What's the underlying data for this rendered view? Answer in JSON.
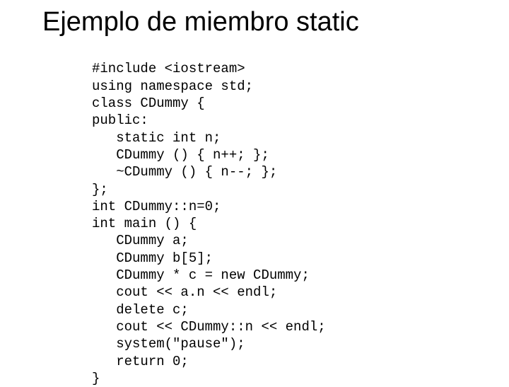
{
  "title": "Ejemplo de miembro static",
  "code": {
    "l1": "#include <iostream>",
    "l2": "using namespace std;",
    "l3": "class CDummy {",
    "l4": "public:",
    "l5": "   static int n;",
    "l6": "   CDummy () { n++; };",
    "l7": "   ~CDummy () { n--; };",
    "l8": "};",
    "l9": "int CDummy::n=0;",
    "l10": "int main () {",
    "l11": "   CDummy a;",
    "l12": "   CDummy b[5];",
    "l13": "   CDummy * c = new CDummy;",
    "l14": "   cout << a.n << endl;",
    "l15": "   delete c;",
    "l16": "   cout << CDummy::n << endl;",
    "l17": "   system(\"pause\");",
    "l18": "   return 0;",
    "l19": "}"
  }
}
